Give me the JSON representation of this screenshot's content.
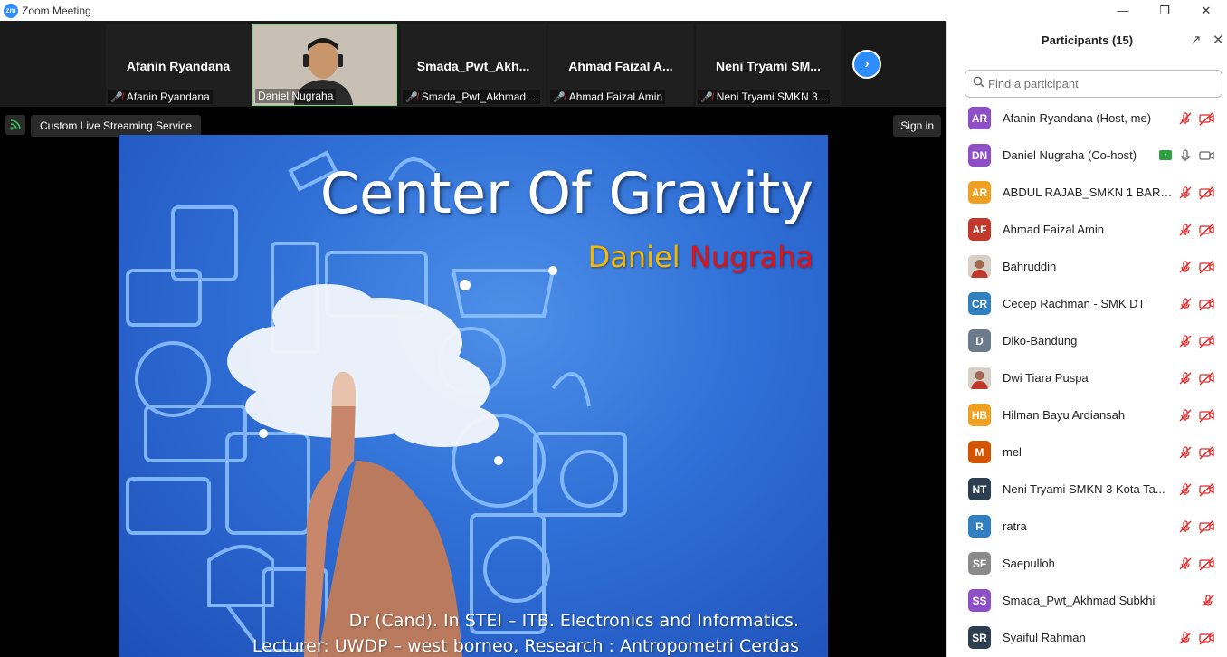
{
  "window": {
    "title": "Zoom Meeting"
  },
  "strip": {
    "tiles": [
      {
        "name": "Afanin Ryandana",
        "label": "Afanin Ryandana",
        "muted": true,
        "video": false
      },
      {
        "name": "",
        "label": "Daniel Nugraha",
        "muted": false,
        "video": true
      },
      {
        "name": "Smada_Pwt_Akh...",
        "label": "Smada_Pwt_Akhmad ...",
        "muted": true,
        "video": false
      },
      {
        "name": "Ahmad Faizal A...",
        "label": "Ahmad Faizal Amin",
        "muted": true,
        "video": false
      },
      {
        "name": "Neni Tryami SM...",
        "label": "Neni Tryami SMKN  3...",
        "muted": true,
        "video": false
      }
    ]
  },
  "live_streaming": {
    "label": "Custom Live Streaming Service"
  },
  "sign_in": {
    "label": "Sign in"
  },
  "slide": {
    "title": "Center Of Gravity",
    "author_first": "Daniel",
    "author_last": "Nugraha",
    "line1": "Dr (Cand). In STEI – ITB. Electronics and Informatics.",
    "line2": "Lecturer: UWDP – west borneo, Research : Antropometri Cerdas"
  },
  "participants": {
    "title": "Participants (15)",
    "search_placeholder": "Find a participant",
    "list": [
      {
        "initials": "AR",
        "name": "Afanin Ryandana (Host, me)",
        "color": "#8e4ec6",
        "mic": "muted",
        "cam": "off"
      },
      {
        "initials": "DN",
        "name": "Daniel Nugraha (Co-host)",
        "color": "#8e4ec6",
        "mic": "on",
        "cam": "on",
        "sharing": true
      },
      {
        "initials": "AR",
        "name": "ABDUL RAJAB_SMKN 1 BARRU",
        "color": "#f0a020",
        "mic": "muted",
        "cam": "off"
      },
      {
        "initials": "AF",
        "name": "Ahmad Faizal Amin",
        "color": "#c0392b",
        "mic": "muted",
        "cam": "off"
      },
      {
        "initials": "",
        "name": "Bahruddin",
        "color": "#d8d0c8",
        "mic": "muted",
        "cam": "off",
        "photo": true
      },
      {
        "initials": "CR",
        "name": "Cecep Rachman - SMK DT",
        "color": "#2f7fc1",
        "mic": "muted",
        "cam": "off"
      },
      {
        "initials": "D",
        "name": "Diko-Bandung",
        "color": "#6b7b8c",
        "mic": "muted",
        "cam": "off"
      },
      {
        "initials": "",
        "name": "Dwi Tiara Puspa",
        "color": "#c9a8b8",
        "mic": "muted",
        "cam": "off",
        "photo": true
      },
      {
        "initials": "HB",
        "name": "Hilman Bayu Ardiansah",
        "color": "#f0a020",
        "mic": "muted",
        "cam": "off"
      },
      {
        "initials": "M",
        "name": "mel",
        "color": "#d35400",
        "mic": "muted",
        "cam": "off"
      },
      {
        "initials": "NT",
        "name": "Neni Tryami SMKN  3 Kota  Ta...",
        "color": "#2c3e50",
        "mic": "muted",
        "cam": "off"
      },
      {
        "initials": "R",
        "name": "ratra",
        "color": "#2f7fc1",
        "mic": "muted",
        "cam": "off"
      },
      {
        "initials": "SF",
        "name": "Saepulloh",
        "color": "#8a8a8a",
        "mic": "muted",
        "cam": "off",
        "photo": true
      },
      {
        "initials": "SS",
        "name": "Smada_Pwt_Akhmad Subkhi",
        "color": "#8e4ec6",
        "mic": "muted",
        "cam": "none"
      },
      {
        "initials": "SR",
        "name": "Syaiful Rahman",
        "color": "#2c3e50",
        "mic": "muted",
        "cam": "off"
      }
    ]
  },
  "colors": {
    "accent": "#2d8cff",
    "muted": "#e02828",
    "share": "#2ea043"
  }
}
